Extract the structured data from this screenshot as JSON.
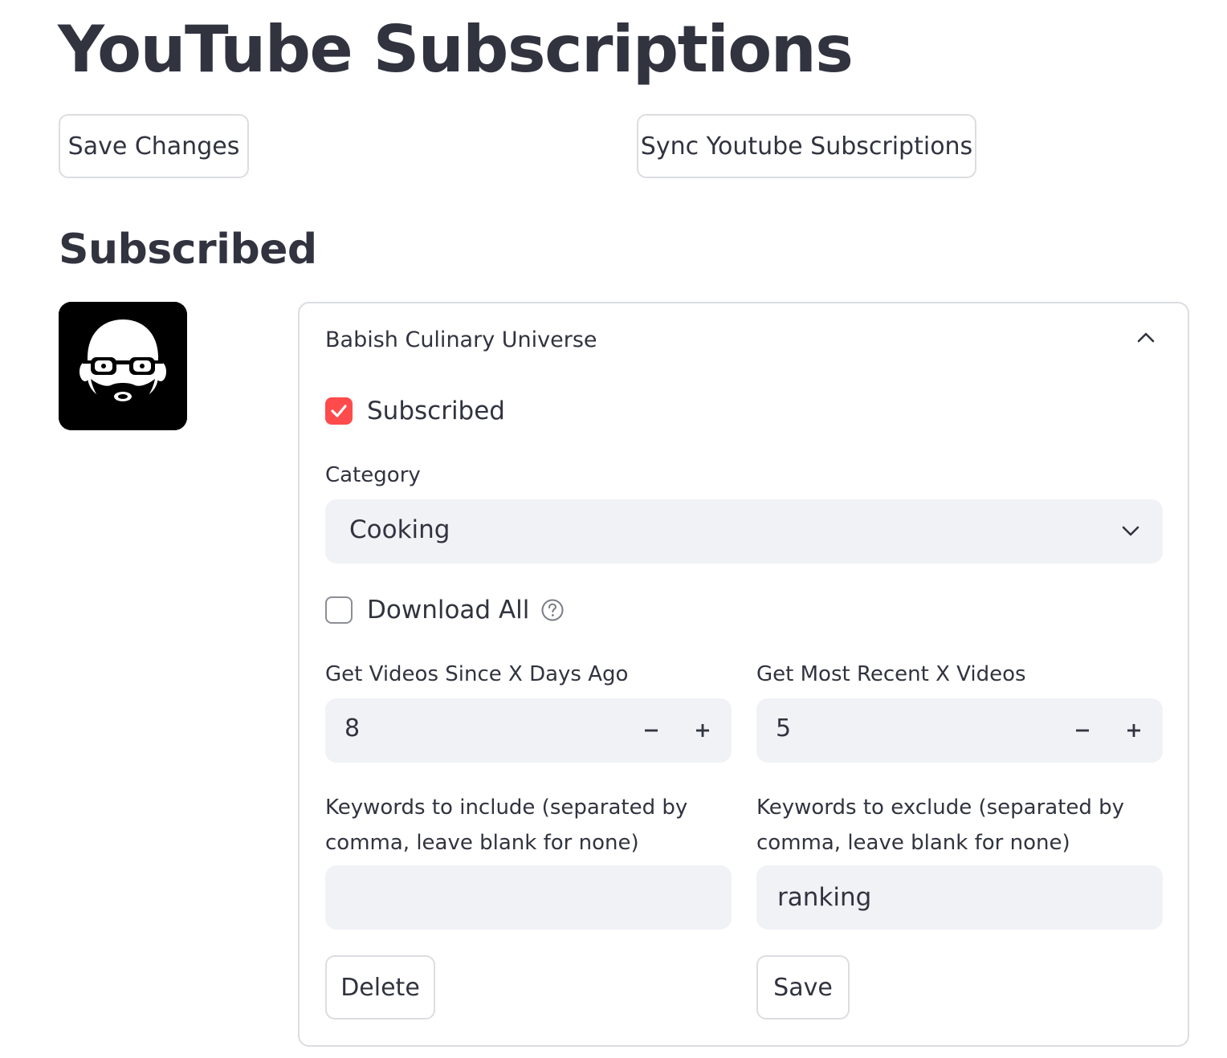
{
  "page": {
    "title": "YouTube Subscriptions",
    "save_changes_label": "Save Changes",
    "sync_label": "Sync Youtube Subscriptions",
    "section_title": "Subscribed"
  },
  "channel": {
    "name": "Babish Culinary Universe",
    "subscribed_label": "Subscribed",
    "subscribed_checked": true,
    "category_label": "Category",
    "category_value": "Cooking",
    "download_all_label": "Download All",
    "download_all_checked": false,
    "days_label": "Get Videos Since X Days Ago",
    "days_value": "8",
    "recent_label": "Get Most Recent X Videos",
    "recent_value": "5",
    "include_label": "Keywords to include (separated by comma, leave blank for none)",
    "include_value": "",
    "exclude_label": "Keywords to exclude (separated by comma, leave blank for none)",
    "exclude_value": "ranking",
    "delete_label": "Delete",
    "save_label": "Save"
  },
  "stepper": {
    "minus": "−",
    "plus": "+"
  },
  "icons": {
    "avatar": "babish-avatar-icon",
    "collapse": "chevron-up-icon",
    "dropdown": "chevron-down-icon",
    "help": "question-circle-icon",
    "check": "check-icon"
  },
  "colors": {
    "accent": "#ff4b4b",
    "input_bg": "#f0f2f6",
    "text": "#31333f",
    "border": "#dcdde1"
  }
}
